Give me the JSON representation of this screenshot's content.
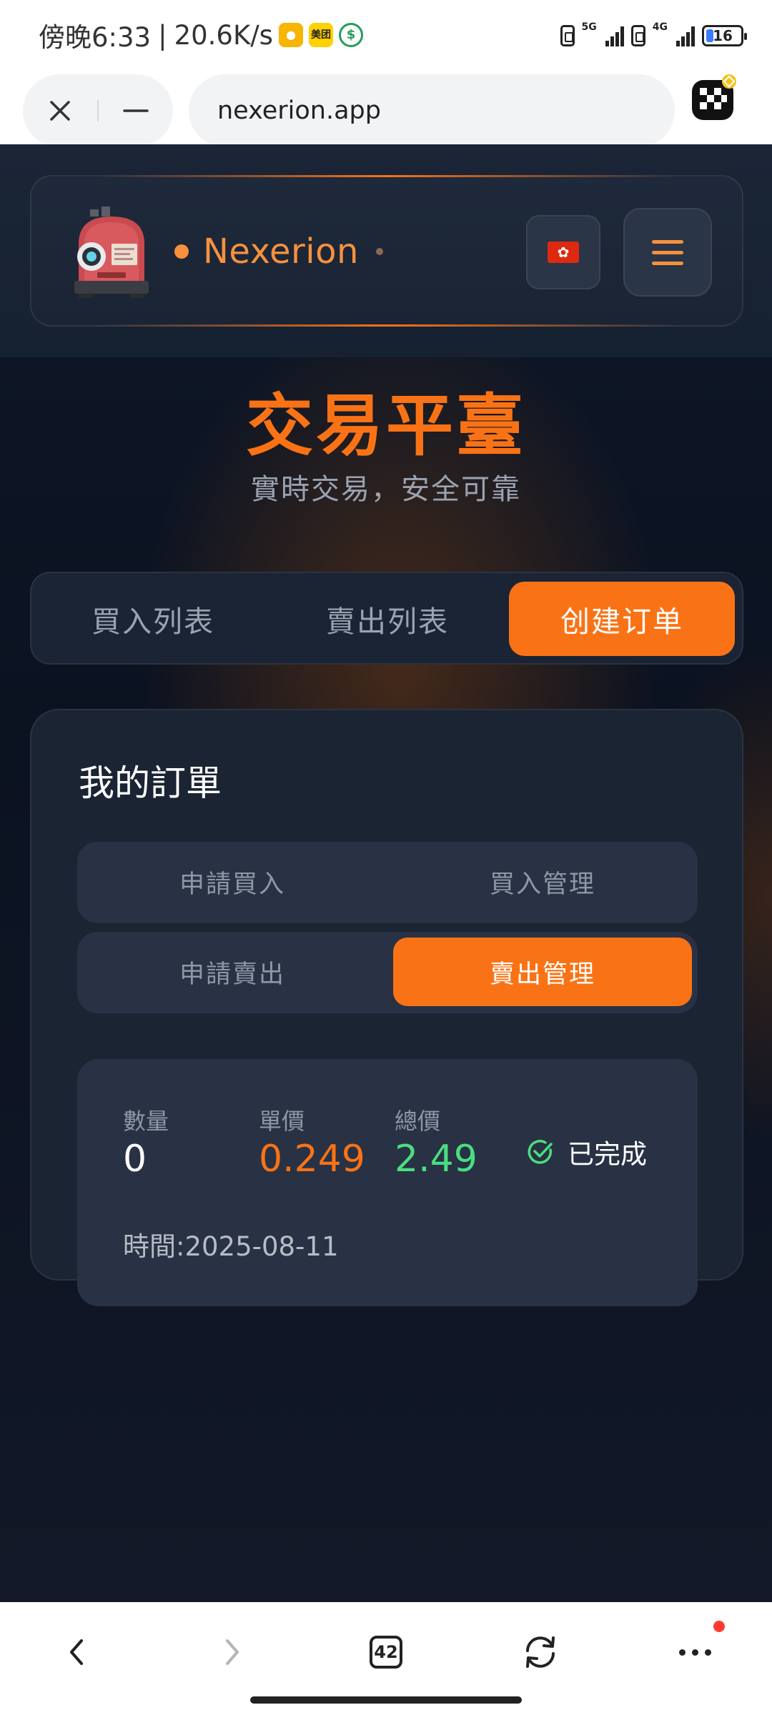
{
  "status_bar": {
    "time": "傍晚6:33",
    "speed": "20.6K/s",
    "app_icons": [
      "message-icon",
      "meituan-icon",
      "payment-icon"
    ],
    "network_1": "5G",
    "network_2": "4G",
    "battery": "16"
  },
  "browser": {
    "url": "nexerion.app"
  },
  "header": {
    "brand": "Nexerion",
    "language_flag": "hong-kong-flag",
    "accent_color": "#f97316"
  },
  "page": {
    "title": "交易平臺",
    "subtitle": "實時交易，安全可靠"
  },
  "main_tabs": [
    {
      "label": "買入列表",
      "active": false
    },
    {
      "label": "賣出列表",
      "active": false
    },
    {
      "label": "创建订单",
      "active": true
    }
  ],
  "orders": {
    "title": "我的訂單",
    "sub_tabs_row1": [
      {
        "label": "申請買入",
        "active": false
      },
      {
        "label": "買入管理",
        "active": false
      }
    ],
    "sub_tabs_row2": [
      {
        "label": "申請賣出",
        "active": false
      },
      {
        "label": "賣出管理",
        "active": true
      }
    ],
    "items": [
      {
        "qty_label": "數量",
        "qty": "0",
        "price_label": "單價",
        "price": "0.249",
        "total_label": "總價",
        "total": "2.49",
        "status": "已完成",
        "time": "時間:2025-08-11"
      }
    ]
  },
  "bottom_nav": {
    "tab_count": "42"
  }
}
